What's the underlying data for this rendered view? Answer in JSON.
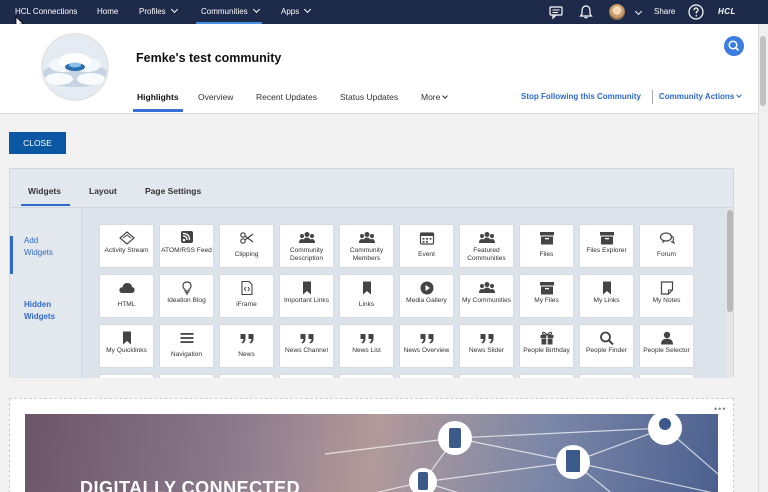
{
  "topnav": {
    "brand": "HCL Connections",
    "items": [
      {
        "label": "Home"
      },
      {
        "label": "Profiles"
      },
      {
        "label": "Communities"
      },
      {
        "label": "Apps"
      }
    ],
    "share_label": "Share",
    "logo_text": "HCL"
  },
  "community": {
    "title": "Femke's test community",
    "tabs": [
      {
        "label": "Highlights"
      },
      {
        "label": "Overview"
      },
      {
        "label": "Recent Updates"
      },
      {
        "label": "Status Updates"
      },
      {
        "label": "More"
      }
    ],
    "stop_following_label": "Stop Following this Community",
    "actions_label": "Community Actions"
  },
  "close_label": "CLOSE",
  "panel": {
    "tabs": [
      {
        "label": "Widgets"
      },
      {
        "label": "Layout"
      },
      {
        "label": "Page Settings"
      }
    ],
    "side_links": [
      {
        "label": "Add\nWidgets"
      },
      {
        "label": "Hidden\nWidgets"
      }
    ],
    "widgets": [
      {
        "label": "Activity Stream",
        "icon": "activity-stream-icon"
      },
      {
        "label": "ATOM/RSS Feed",
        "icon": "rss-icon"
      },
      {
        "label": "Clipping",
        "icon": "scissors-icon"
      },
      {
        "label": "Community Description",
        "icon": "people-group-icon"
      },
      {
        "label": "Community Members",
        "icon": "people-group-icon"
      },
      {
        "label": "Event",
        "icon": "calendar-icon"
      },
      {
        "label": "Featured Communities",
        "icon": "people-group-icon"
      },
      {
        "label": "Files",
        "icon": "box-icon"
      },
      {
        "label": "Files Explorer",
        "icon": "box-icon"
      },
      {
        "label": "Forum",
        "icon": "chat-bubbles-icon"
      },
      {
        "label": "HTML",
        "icon": "cloud-icon"
      },
      {
        "label": "Ideation Blog",
        "icon": "lightbulb-icon"
      },
      {
        "label": "iFrame",
        "icon": "code-file-icon"
      },
      {
        "label": "Important Links",
        "icon": "bookmark-icon"
      },
      {
        "label": "Links",
        "icon": "bookmark-icon"
      },
      {
        "label": "Media Gallery",
        "icon": "play-icon"
      },
      {
        "label": "My Communities",
        "icon": "people-group-icon"
      },
      {
        "label": "My Files",
        "icon": "box-icon"
      },
      {
        "label": "My Links",
        "icon": "bookmark-icon"
      },
      {
        "label": "My Notes",
        "icon": "note-icon"
      },
      {
        "label": "My Quicklinks",
        "icon": "bookmark-icon"
      },
      {
        "label": "Navigation",
        "icon": "menu-icon"
      },
      {
        "label": "News",
        "icon": "quote-icon"
      },
      {
        "label": "News Channel",
        "icon": "quote-icon"
      },
      {
        "label": "News List",
        "icon": "quote-icon"
      },
      {
        "label": "News Overview",
        "icon": "quote-icon"
      },
      {
        "label": "News Slider",
        "icon": "quote-icon"
      },
      {
        "label": "People Birthday",
        "icon": "gift-icon"
      },
      {
        "label": "People Finder",
        "icon": "search-icon"
      },
      {
        "label": "People Selector",
        "icon": "person-icon"
      }
    ]
  },
  "hero": {
    "text": "DIGITALLY CONNECTED"
  },
  "colors": {
    "nav_bg": "#1e2a4a",
    "accent": "#2f6ac9",
    "close_button": "#0a57a3"
  }
}
